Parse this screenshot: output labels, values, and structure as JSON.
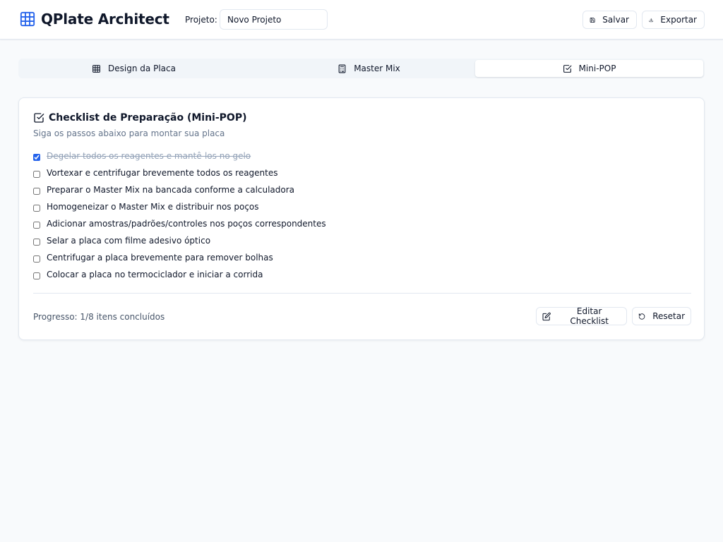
{
  "header": {
    "app_title": "QPlate Architect",
    "logo_icon": "grid-icon",
    "project_label": "Projeto:",
    "project_value": "Novo Projeto",
    "save_label": "Salvar",
    "export_label": "Exportar"
  },
  "tabs": [
    {
      "label": "Design da Placa",
      "icon": "grid-icon",
      "active": false
    },
    {
      "label": "Master Mix",
      "icon": "calculator-icon",
      "active": false
    },
    {
      "label": "Mini-POP",
      "icon": "check-square-icon",
      "active": true
    }
  ],
  "checklist": {
    "title": "Checklist de Preparação (Mini-POP)",
    "subtitle": "Siga os passos abaixo para montar sua placa",
    "items": [
      {
        "label": "Degelar todos os reagentes e mantê-los no gelo",
        "checked": true
      },
      {
        "label": "Vortexar e centrifugar brevemente todos os reagentes",
        "checked": false
      },
      {
        "label": "Preparar o Master Mix na bancada conforme a calculadora",
        "checked": false
      },
      {
        "label": "Homogeneizar o Master Mix e distribuir nos poços",
        "checked": false
      },
      {
        "label": "Adicionar amostras/padrões/controles nos poços correspondentes",
        "checked": false
      },
      {
        "label": "Selar a placa com filme adesivo óptico",
        "checked": false
      },
      {
        "label": "Centrifugar a placa brevemente para remover bolhas",
        "checked": false
      },
      {
        "label": "Colocar a placa no termociclador e iniciar a corrida",
        "checked": false
      }
    ],
    "progress_text": "Progresso: 1/8 itens concluídos",
    "edit_label": "Editar Checklist",
    "reset_label": "Resetar"
  },
  "colors": {
    "accent": "#2563eb",
    "background": "#f8fafc",
    "border": "#e2e8f0",
    "muted_text": "#64748b"
  }
}
